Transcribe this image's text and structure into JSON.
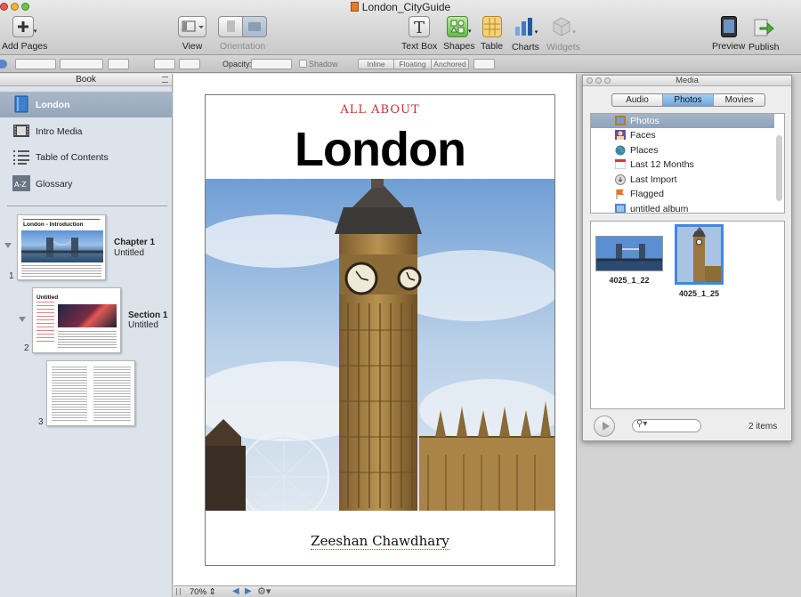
{
  "window": {
    "title": "London_CityGuide"
  },
  "toolbar": {
    "add_pages": "Add Pages",
    "view": "View",
    "orientation": "Orientation",
    "text_box": "Text Box",
    "shapes": "Shapes",
    "table": "Table",
    "charts": "Charts",
    "widgets": "Widgets",
    "preview": "Preview",
    "publish": "Publish"
  },
  "format_bar": {
    "opacity_label": "Opacity:",
    "shadow_label": "Shadow",
    "wrap_inline": "Inline",
    "wrap_floating": "Floating",
    "wrap_anchored": "Anchored"
  },
  "sidebar": {
    "header": "Book",
    "items": [
      {
        "label": "London",
        "icon": "book-icon",
        "selected": true
      },
      {
        "label": "Intro Media",
        "icon": "film-icon"
      },
      {
        "label": "Table of Contents",
        "icon": "list-icon"
      },
      {
        "label": "Glossary",
        "icon": "glossary-icon"
      }
    ],
    "pages": [
      {
        "number": "1",
        "title": "Chapter 1",
        "subtitle": "Untitled",
        "thumb_title": "London - Introduction"
      },
      {
        "number": "2",
        "title": "Section 1",
        "subtitle": "Untitled",
        "thumb_title": "Untitled"
      },
      {
        "number": "3"
      }
    ]
  },
  "page": {
    "kicker": "ALL ABOUT",
    "title": "London",
    "author": "Zeeshan Chawdhary"
  },
  "statusbar": {
    "zoom": "70%"
  },
  "media": {
    "title": "Media",
    "tabs": [
      {
        "label": "Audio"
      },
      {
        "label": "Photos",
        "active": true
      },
      {
        "label": "Movies"
      }
    ],
    "sources": [
      {
        "label": "Photos",
        "selected": true,
        "icon": "photos-icon"
      },
      {
        "label": "Faces",
        "icon": "faces-icon"
      },
      {
        "label": "Places",
        "icon": "globe-icon"
      },
      {
        "label": "Last 12 Months",
        "icon": "calendar-icon"
      },
      {
        "label": "Last Import",
        "icon": "import-icon"
      },
      {
        "label": "Flagged",
        "icon": "flag-icon"
      },
      {
        "label": "untitled album",
        "icon": "album-icon"
      }
    ],
    "photos": [
      {
        "caption": "4025_1_22"
      },
      {
        "caption": "4025_1_25",
        "selected": true
      }
    ],
    "count": "2 items"
  }
}
